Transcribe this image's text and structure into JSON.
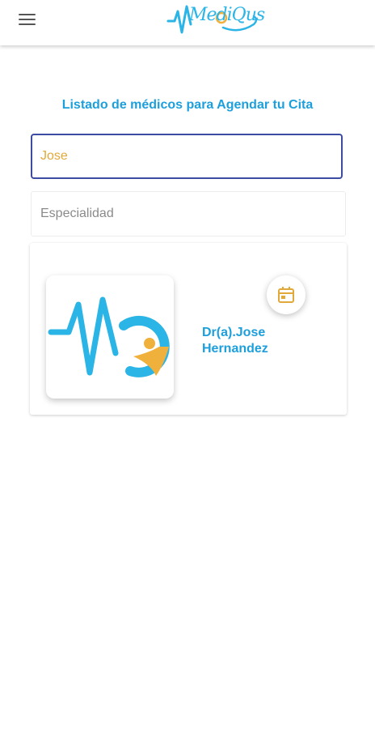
{
  "header": {
    "menu_icon": "hamburger-menu-icon",
    "logo_text": "MediQus"
  },
  "page": {
    "title": "Listado de médicos para Agendar tu Cita"
  },
  "search": {
    "value": "Jose"
  },
  "specialty": {
    "placeholder": "Especialidad",
    "value": ""
  },
  "doctors": [
    {
      "name": "Dr(a).Jose Hernandez",
      "action_icon": "calendar-icon"
    }
  ],
  "colors": {
    "accent": "#1d9fdc",
    "input_border_focus": "#3d4ca3",
    "input_text": "#e0a93a",
    "calendar_icon": "#e0a93a"
  }
}
